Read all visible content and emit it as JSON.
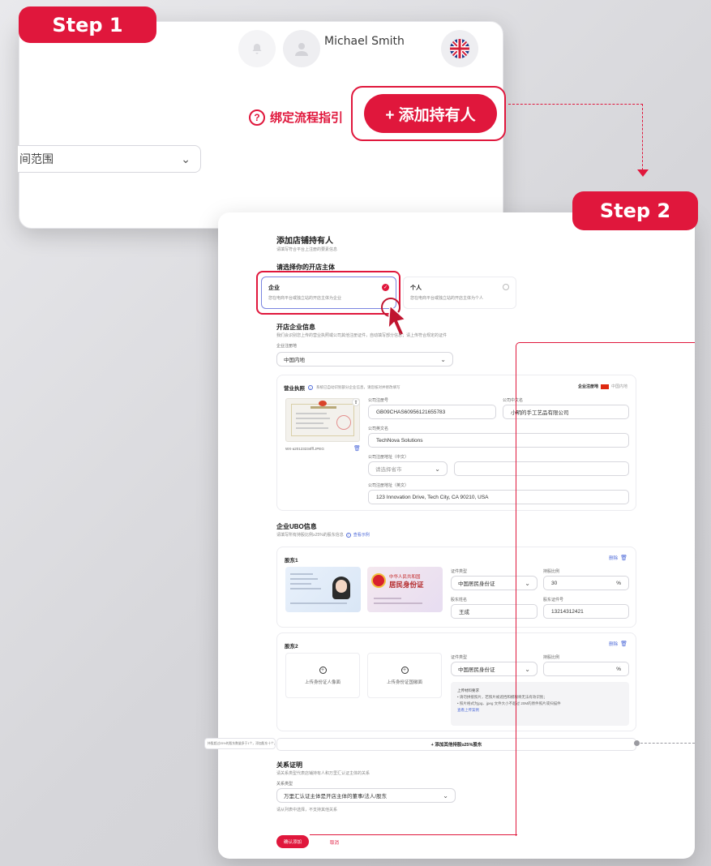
{
  "step1": {
    "badge": "Step 1",
    "user_name": "Michael Smith",
    "guide_icon": "question-circle-icon",
    "guide_text": "绑定流程指引",
    "add_button": "+ 添加持有人",
    "range_select": "间范围",
    "chevron": "chevron-down-icon",
    "language_icon": "uk-flag-icon"
  },
  "step2": {
    "badge": "Step 2",
    "title": "添加店铺持有人",
    "subtitle": "请填写符合平台上注册的要素信息",
    "entity_heading": "请选择你的开店主体",
    "entity_options": [
      {
        "label": "企业",
        "desc": "您在电商平台或独立站的开店主体为企业",
        "selected": true
      },
      {
        "label": "个人",
        "desc": "您在电商平台或独立站的开店主体为个人",
        "selected": false
      }
    ],
    "company_heading": "开店企业信息",
    "company_desc": "我们会识别您上传的营业执照或公司其他注册证件，自动填写部分信息；请上传符合规定的证件",
    "reg_place_label": "企业注册地",
    "reg_place_value": "中国内地",
    "license": {
      "title": "营业执照",
      "hint": "系统已自动识别部分企业信息，请您核对并修改填写",
      "region_label": "企业注册地",
      "region_value": "中国内地",
      "file_name": "WX-a20123234fff.JPEG",
      "reg_no_label": "公司注册号",
      "reg_no_value": "GB09CHAS60956121655783",
      "cn_name_label": "公司中文名",
      "cn_name_value": "小明的手工艺品有限公司",
      "en_name_label": "公司英文名",
      "en_name_value": "TechNova Solutions",
      "addr_cn_label": "公司注册地址（中文）",
      "addr_cn_placeholder": "请选择省市",
      "addr_en_label": "公司注册地址（英文）",
      "addr_en_value": "123 Innovation Drive, Tech City, CA 90210, USA"
    },
    "ubo_heading": "企业UBO信息",
    "ubo_desc": "请填写所有持股比例≥25%的股东信息",
    "ubo_example": "查看示例",
    "shareholders": [
      {
        "title": "股东1",
        "delete": "删除",
        "id_type_label": "证件类型",
        "id_type_value": "中国居民身份证",
        "ratio_label": "持股比例",
        "ratio_value": "30",
        "name_label": "股东姓名",
        "name_value": "王成",
        "id_no_label": "股东证件号",
        "id_no_value": "13214312421",
        "id_back_line1": "中华人民共和国",
        "id_back_line2": "居民身份证"
      },
      {
        "title": "股东2",
        "delete": "删除",
        "upload_front": "上传身份证人像面",
        "upload_back": "上传身份证国徽面",
        "id_type_label": "证件类型",
        "id_type_value": "中国居民身份证",
        "ratio_label": "持股比例",
        "req_title": "上传材料要求",
        "req_1": "• 请勿拼接照片，若照片被遮挡和模糊将无法有效识别；",
        "req_2": "• 照片格式为jpg、jpeg 文件大小不超过 20M的原件照片或扫描件",
        "req_link": "查看上传案例"
      }
    ],
    "add_shareholder": "+ 添加其他持股≥25%股东",
    "side_note": "持股超过25%的股东数量多于1个，添加股东十个，最多十个",
    "relation_heading": "关系证明",
    "relation_desc": "请关系类型代表店铺持有人和万里汇认证主体的关系",
    "relation_type_label": "关系类型",
    "relation_type_value": "万里汇认证主体是开店主体的董事/法人/股东",
    "relation_note": "请从列表中选择，不支持其他关系",
    "confirm_button": "确认添加",
    "cancel_button": "取消"
  }
}
